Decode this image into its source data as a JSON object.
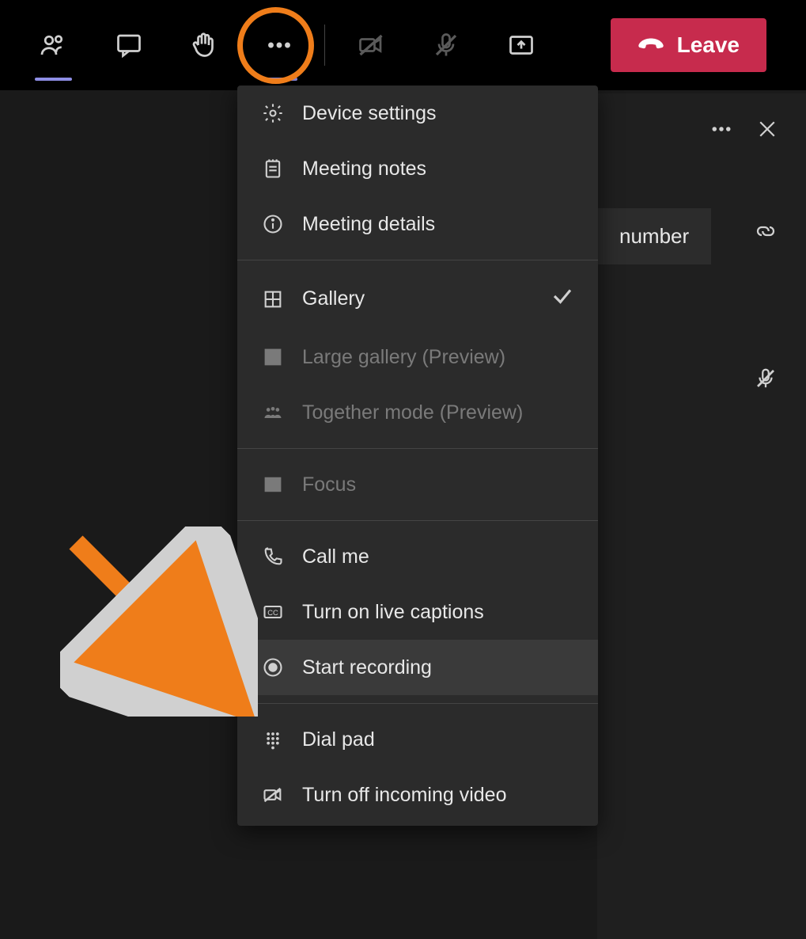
{
  "toolbar": {
    "leave_label": "Leave"
  },
  "panel": {
    "number_fragment": "number"
  },
  "menu": {
    "device_settings": "Device settings",
    "meeting_notes": "Meeting notes",
    "meeting_details": "Meeting details",
    "gallery": "Gallery",
    "large_gallery": "Large gallery (Preview)",
    "together_mode": "Together mode (Preview)",
    "focus": "Focus",
    "call_me": "Call me",
    "live_captions": "Turn on live captions",
    "start_recording": "Start recording",
    "dial_pad": "Dial pad",
    "turn_off_incoming": "Turn off incoming video"
  },
  "annotations": {
    "highlight_circle_target": "more-actions-button",
    "highlight_arrow_target": "start-recording-item",
    "highlight_color": "#ef7d1a"
  }
}
